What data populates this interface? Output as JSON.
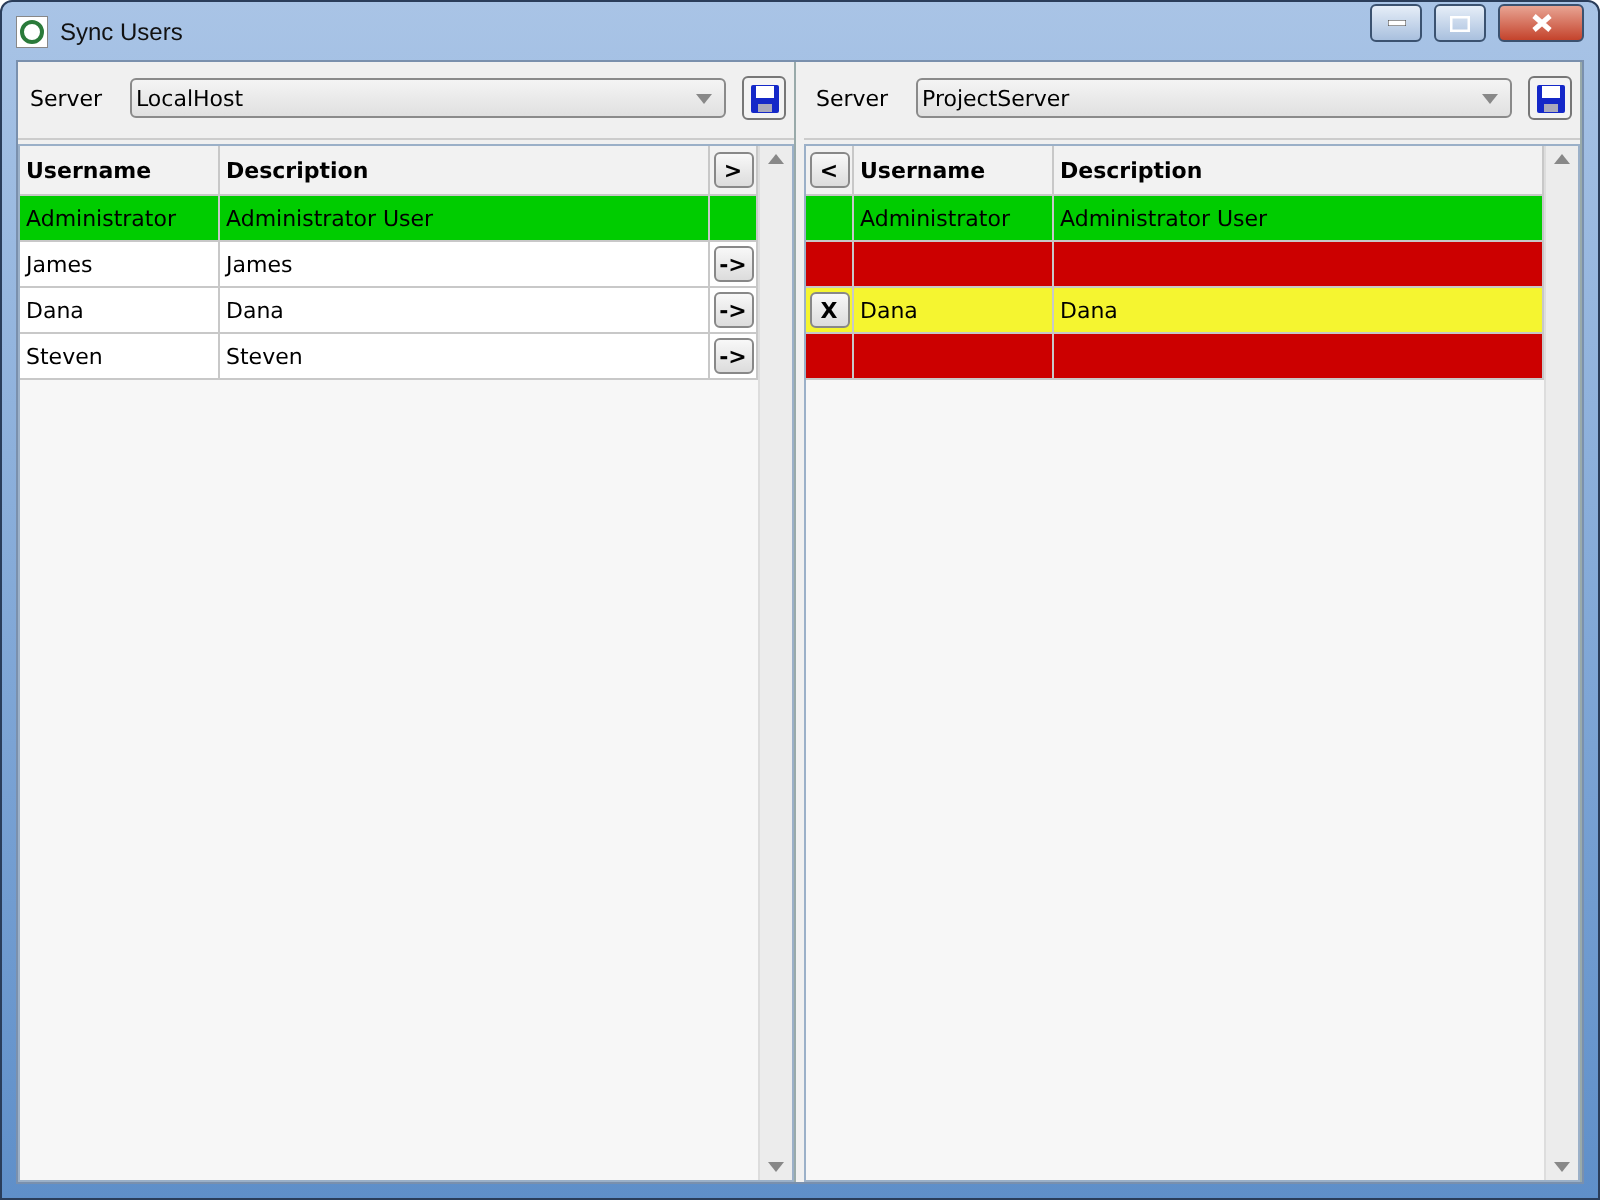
{
  "window": {
    "title": "Sync Users",
    "controls": [
      {
        "kind": "minimize"
      },
      {
        "kind": "maximize"
      },
      {
        "kind": "close"
      }
    ]
  },
  "panels": [
    {
      "kind": "source",
      "server_label": "Server",
      "server": "LocalHost",
      "header_button": ">",
      "columns": [
        "Username",
        "Description"
      ],
      "rows": [
        {
          "username": "Administrator",
          "description": "Administrator User",
          "color": "#00cc00"
        },
        {
          "username": "James",
          "description": "James",
          "color": "#ffffff",
          "action": "->"
        },
        {
          "username": "Dana",
          "description": "Dana",
          "color": "#ffffff",
          "action": "->"
        },
        {
          "username": "Steven",
          "description": "Steven",
          "color": "#ffffff",
          "action": "->"
        }
      ]
    },
    {
      "kind": "target",
      "server_label": "Server",
      "server": "ProjectServer",
      "header_button": "<",
      "columns": [
        "Username",
        "Description"
      ],
      "rows": [
        {
          "username": "Administrator",
          "description": "Administrator User",
          "color": "#00cc00"
        },
        {
          "color": "#cc0000"
        },
        {
          "username": "Dana",
          "description": "Dana",
          "color": "#f5f530",
          "action": "X"
        },
        {
          "color": "#cc0000"
        }
      ]
    }
  ]
}
